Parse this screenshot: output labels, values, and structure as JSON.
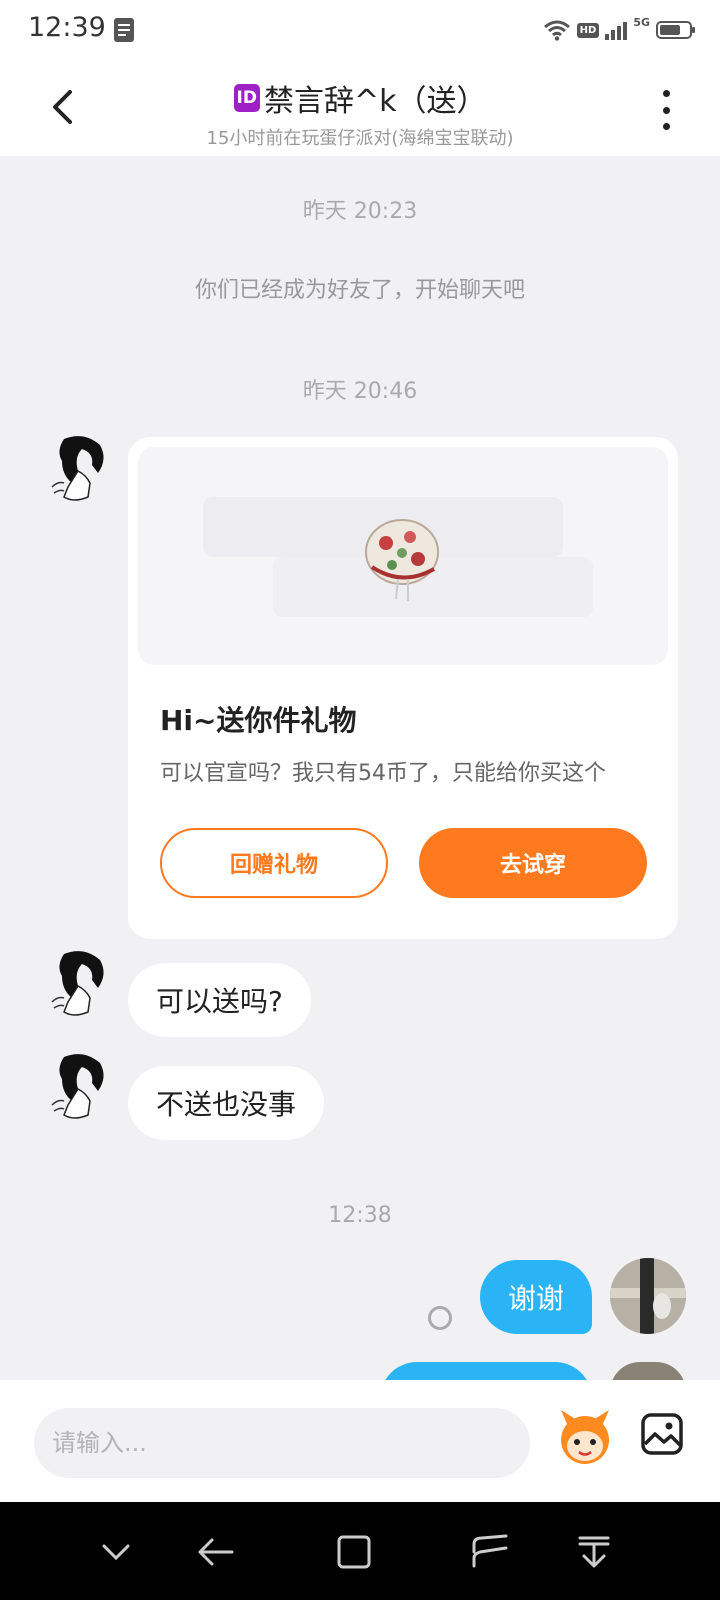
{
  "status_bar": {
    "time": "12:39",
    "network_badge": "HD",
    "network_type": "5G",
    "signal_bars": 4,
    "battery_level": 0.7
  },
  "header": {
    "id_badge": "ID",
    "title": "禁言辞^k（送）",
    "subtitle": "15小时前在玩蛋仔派对(海绵宝宝联动)"
  },
  "messages": {
    "time_1": "昨天 20:23",
    "system_msg": "你们已经成为好友了，开始聊天吧",
    "time_2": "昨天 20:46",
    "gift_card": {
      "title": "Hi~送你件礼物",
      "description": "可以官宣吗？我只有54币了，只能给你买这个",
      "return_gift_label": "回赠礼物",
      "try_on_label": "去试穿"
    },
    "incoming_1": "可以送吗?",
    "incoming_2": "不送也没事",
    "time_3": "12:38",
    "outgoing_1": "谢谢"
  },
  "input": {
    "placeholder": "请输入..."
  },
  "colors": {
    "accent_orange": "#ff7a1f",
    "outgoing_bubble": "#2ab4f5",
    "background": "#f1f1f4"
  },
  "icons": [
    "note-icon",
    "wifi-icon",
    "signal-icon",
    "battery-icon",
    "back-arrow-icon",
    "more-vertical-icon",
    "emoji-icon",
    "image-icon",
    "nav-down-icon",
    "nav-back-icon",
    "nav-home-icon",
    "nav-recent-icon",
    "nav-menu-icon"
  ]
}
